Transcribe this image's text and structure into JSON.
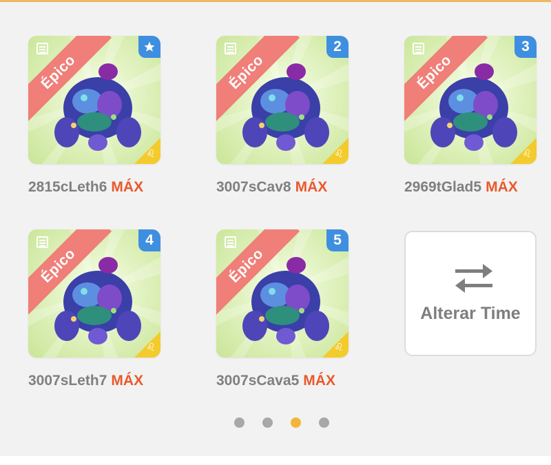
{
  "team": {
    "cards": [
      {
        "rarity": "Épico",
        "badge": "★",
        "name": "2815cLeth6",
        "level": "MÁX"
      },
      {
        "rarity": "Épico",
        "badge": "2",
        "name": "3007sCav8",
        "level": "MÁX"
      },
      {
        "rarity": "Épico",
        "badge": "3",
        "name": "2969tGlad5",
        "level": "MÁX"
      },
      {
        "rarity": "Épico",
        "badge": "4",
        "name": "3007sLeth7",
        "level": "MÁX"
      },
      {
        "rarity": "Épico",
        "badge": "5",
        "name": "3007sCava5",
        "level": "MÁX"
      }
    ],
    "switch_label": "Alterar Time"
  },
  "pagination": {
    "count": 4,
    "active_index": 2
  },
  "colors": {
    "accent_top": "#f0b762",
    "ribbon": "#ef7f78",
    "badge": "#3f8fe0",
    "corner": "#f3cb2c",
    "max_text": "#e9592c",
    "dot_inactive": "#a8a8a8",
    "dot_active": "#f2b53a"
  },
  "icons": {
    "card_top_left": "calendar-icon",
    "card_bottom_right": "leo-zodiac-icon",
    "switch": "swap-arrows-icon"
  }
}
